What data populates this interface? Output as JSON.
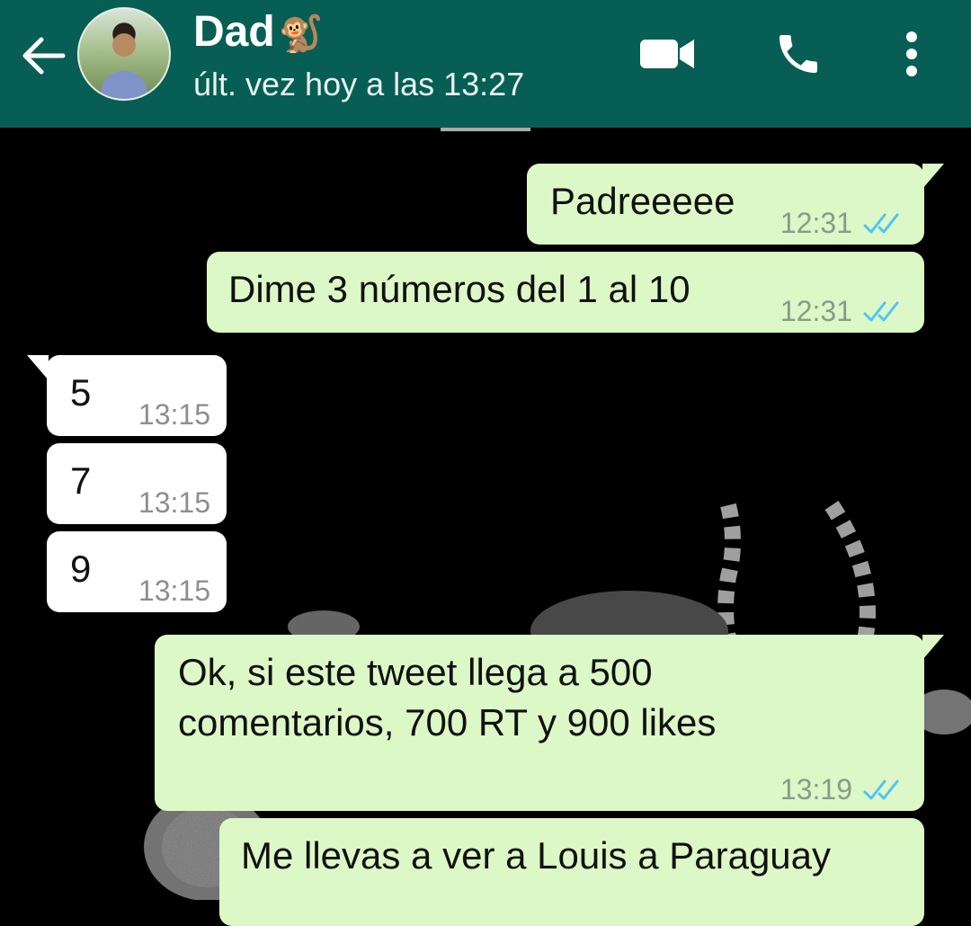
{
  "header": {
    "contact_name": "Dad",
    "contact_emoji": "🐒",
    "last_seen": "últ. vez hoy a las 13:27",
    "icons": [
      "back-arrow-icon",
      "video-call-icon",
      "phone-icon",
      "more-options-icon"
    ]
  },
  "colors": {
    "header_bg": "#075e54",
    "outgoing_bubble": "#dcf8c6",
    "incoming_bubble": "#ffffff",
    "read_ticks": "#4fc3f7",
    "chat_bg": "#000000"
  },
  "messages": [
    {
      "direction": "out",
      "text": "Padreeeee",
      "time": "12:31",
      "status": "read"
    },
    {
      "direction": "out",
      "text": "Dime 3 números del 1 al 10",
      "time": "12:31",
      "status": "read"
    },
    {
      "direction": "in",
      "text": "5",
      "time": "13:15"
    },
    {
      "direction": "in",
      "text": "7",
      "time": "13:15"
    },
    {
      "direction": "in",
      "text": "9",
      "time": "13:15"
    },
    {
      "direction": "out",
      "text_line1": "Ok, si este tweet llega a 500",
      "text_line2": "comentarios, 700 RT y 900 likes",
      "time": "13:19",
      "status": "read"
    },
    {
      "direction": "out",
      "text": "Me llevas a ver a Louis a Paraguay"
    }
  ]
}
